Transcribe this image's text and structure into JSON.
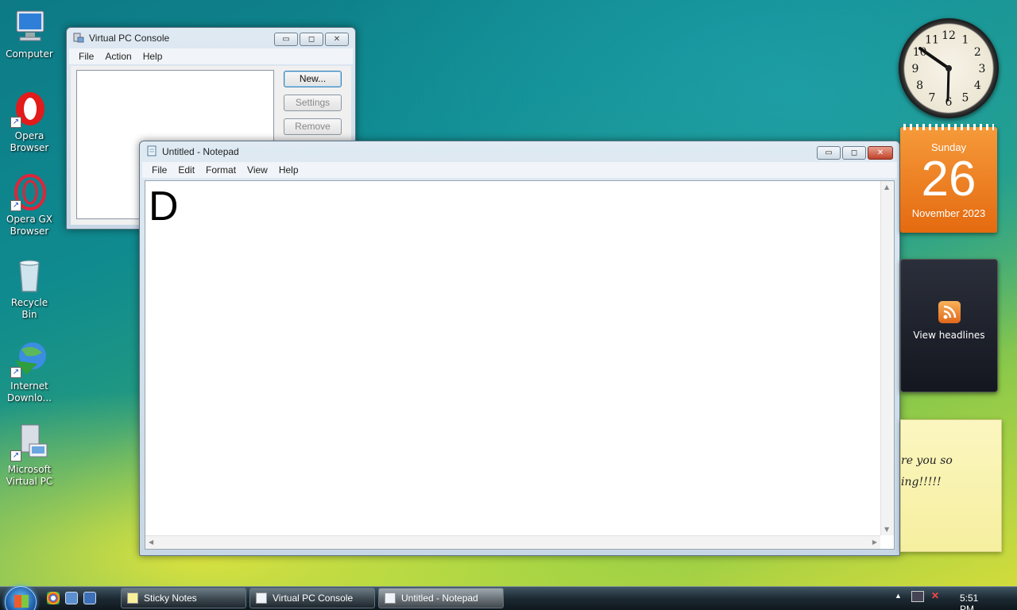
{
  "desktop_icons": [
    {
      "label": "Computer",
      "icon": "computer-icon"
    },
    {
      "label": "Opera Browser",
      "icon": "opera-icon"
    },
    {
      "label": "Opera GX Browser",
      "icon": "opera-gx-icon"
    },
    {
      "label": "Recycle Bin",
      "icon": "recycle-bin-icon"
    },
    {
      "label": "Internet Downlo...",
      "icon": "internet-download-manager-icon"
    },
    {
      "label": "Microsoft Virtual PC",
      "icon": "virtual-pc-icon"
    }
  ],
  "vpc_console": {
    "title": "Virtual PC Console",
    "menu": [
      "File",
      "Action",
      "Help"
    ],
    "buttons": {
      "new": "New...",
      "settings": "Settings",
      "remove": "Remove"
    }
  },
  "notepad": {
    "title": "Untitled - Notepad",
    "menu": [
      "File",
      "Edit",
      "Format",
      "View",
      "Help"
    ],
    "content": "D"
  },
  "window_controls": {
    "minimize": "▭",
    "maximize": "◻",
    "close": "✕"
  },
  "clock": {
    "numerals": [
      "12",
      "1",
      "2",
      "3",
      "4",
      "5",
      "6",
      "7",
      "8",
      "9",
      "10",
      "11"
    ]
  },
  "calendar": {
    "weekday": "Sunday",
    "day": "26",
    "month_year": "November 2023"
  },
  "feed_gadget": {
    "label": "View headlines"
  },
  "sticky_note": {
    "line1": "re you so",
    "line2": "ing!!!!!"
  },
  "taskbar": {
    "tasks": [
      "Sticky Notes",
      "Virtual PC Console",
      "Untitled - Notepad"
    ],
    "time": "5:51 PM"
  }
}
